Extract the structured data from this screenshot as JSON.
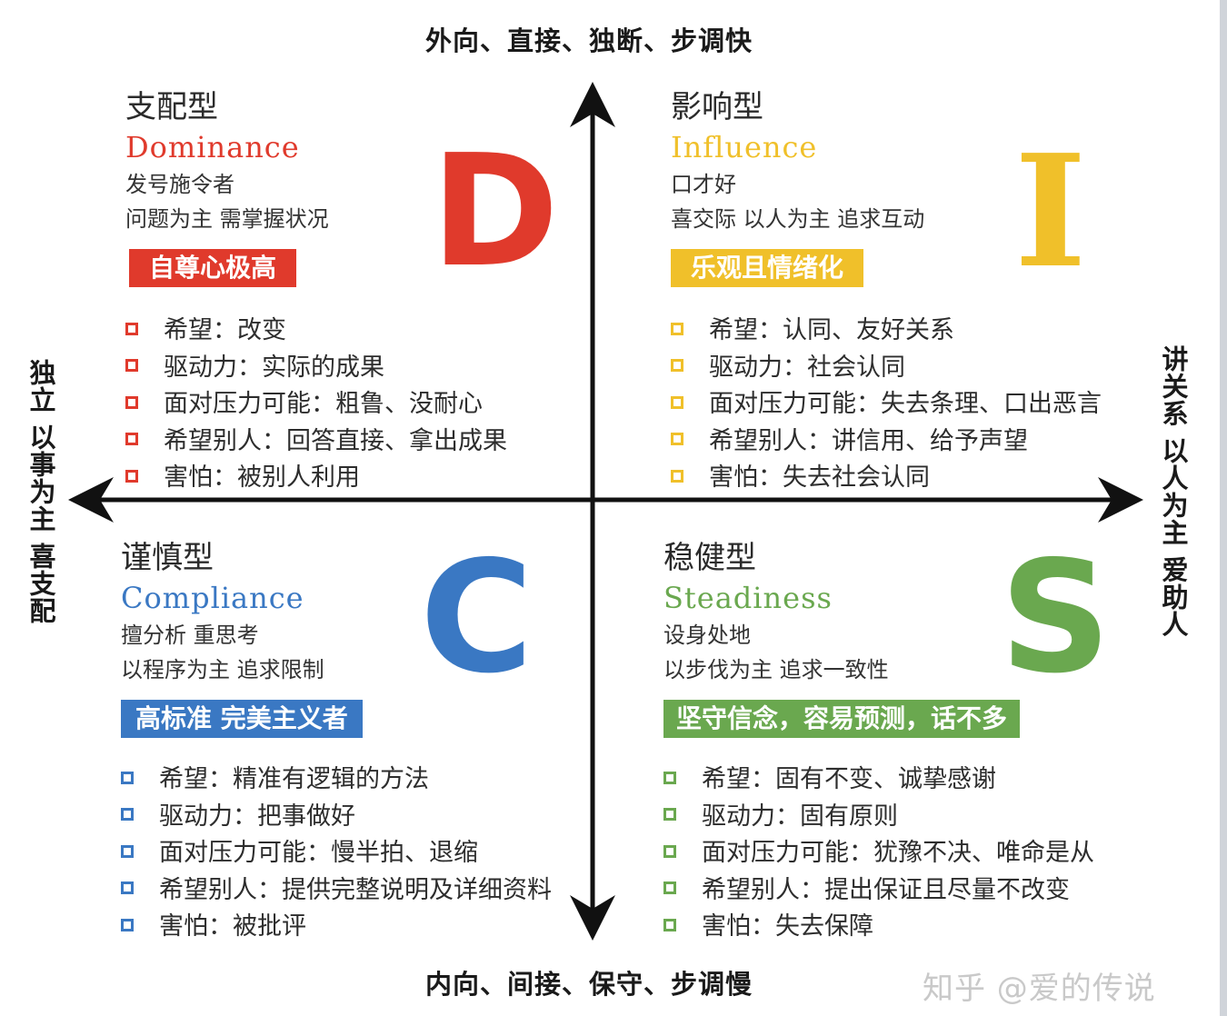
{
  "axes": {
    "top": "外向、直接、独断、步调快",
    "bottom": "内向、间接、保守、步调慢",
    "left": "独立 以事为主 喜支配",
    "right": "讲关系 以人为主 爱助人"
  },
  "quadrants": {
    "d": {
      "title": "支配型",
      "english": "Dominance",
      "letter": "D",
      "color": "#e03a2c",
      "desc1": "发号施令者",
      "desc2": "问题为主 需掌握状况",
      "tag": "自尊心极高",
      "items": [
        "希望：改变",
        "驱动力：实际的成果",
        "面对压力可能：粗鲁、没耐心",
        "希望别人：回答直接、拿出成果",
        "害怕：被别人利用"
      ]
    },
    "i": {
      "title": "影响型",
      "english": "Influence",
      "letter": "I",
      "color": "#f0c02a",
      "desc1": "口才好",
      "desc2": "喜交际 以人为主 追求互动",
      "tag": "乐观且情绪化",
      "items": [
        "希望：认同、友好关系",
        "驱动力：社会认同",
        "面对压力可能：失去条理、口出恶言",
        "希望别人：讲信用、给予声望",
        "害怕：失去社会认同"
      ]
    },
    "c": {
      "title": "谨慎型",
      "english": "Compliance",
      "letter": "C",
      "color": "#3a78c3",
      "desc1": "擅分析 重思考",
      "desc2": "以程序为主 追求限制",
      "tag": "高标准 完美主义者",
      "items": [
        "希望：精准有逻辑的方法",
        "驱动力：把事做好",
        "面对压力可能：慢半拍、退缩",
        "希望别人：提供完整说明及详细资料",
        "害怕：被批评"
      ]
    },
    "s": {
      "title": "稳健型",
      "english": "Steadiness",
      "letter": "S",
      "color": "#6aa84f",
      "desc1": "设身处地",
      "desc2": "以步伐为主 追求一致性",
      "tag": "坚守信念，容易预测，话不多",
      "items": [
        "希望：固有不变、诚挚感谢",
        "驱动力：固有原则",
        "面对压力可能：犹豫不决、唯命是从",
        "希望别人：提出保证且尽量不改变",
        "害怕：失去保障"
      ]
    }
  },
  "watermark": "知乎 @爱的传说"
}
